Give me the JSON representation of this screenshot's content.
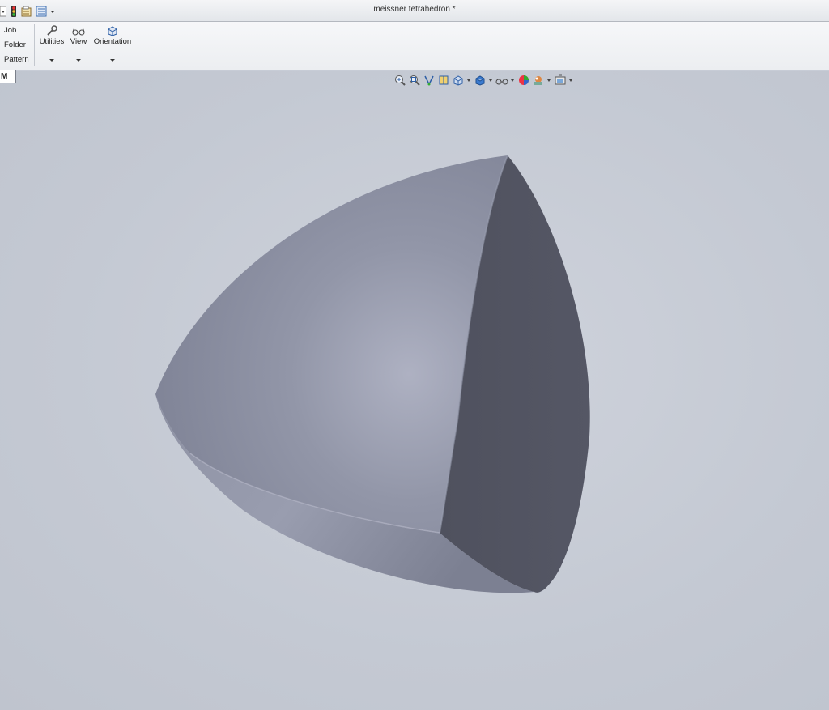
{
  "window": {
    "title": "meissner tetrahedron *"
  },
  "quick_access": {
    "icons": [
      "dropdown-icon",
      "traffic-light-icon",
      "file-properties-icon",
      "options-icon",
      "chevron-down-icon"
    ]
  },
  "ribbon": {
    "small_buttons": [
      "Job",
      "Folder",
      "Pattern"
    ],
    "big_buttons": [
      {
        "label": "Utilities",
        "icon": "wrench-icon"
      },
      {
        "label": "View",
        "icon": "glasses-icon"
      },
      {
        "label": "Orientation",
        "icon": "orientation-cube-icon"
      }
    ]
  },
  "document_tab": {
    "label": "M"
  },
  "heads_up_toolbar": {
    "icons": [
      "zoom-to-fit-icon",
      "zoom-to-area-icon",
      "previous-view-icon",
      "section-view-icon",
      "view-orientation-icon",
      "display-style-icon",
      "hide-show-items-icon",
      "edit-appearance-icon",
      "apply-scene-icon",
      "view-settings-icon"
    ]
  },
  "model": {
    "name": "meissner tetrahedron",
    "shape": "meissner-tetrahedron",
    "colors": {
      "lit": "#a9adbd",
      "mid": "#868a9c",
      "dark": "#515360"
    }
  }
}
